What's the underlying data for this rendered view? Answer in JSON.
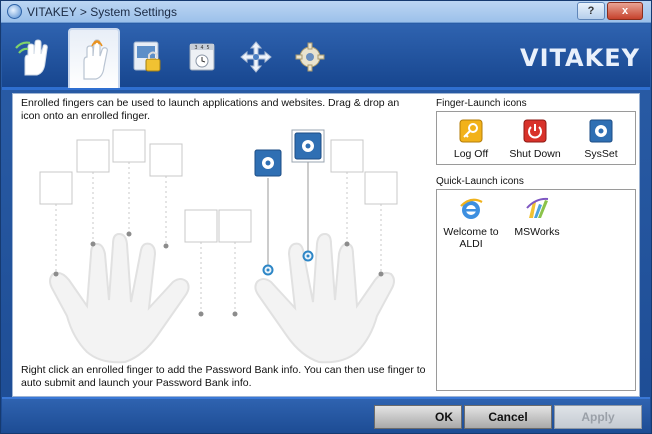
{
  "window": {
    "title": "VITAKEY > System Settings"
  },
  "caption_buttons": {
    "help": "?",
    "close": "x"
  },
  "toolbar": {
    "brand": "VITAKEY",
    "tools": [
      {
        "icon": "hand-wifi-icon"
      },
      {
        "icon": "hand-fingerprint-icon",
        "active": true
      },
      {
        "icon": "password-lock-icon"
      },
      {
        "icon": "time-settings-icon"
      },
      {
        "icon": "move-arrows-icon"
      },
      {
        "icon": "gear-icon"
      }
    ]
  },
  "main": {
    "intro": "Enrolled fingers can be used to launch applications and websites. Drag & drop an icon onto an enrolled finger.",
    "footer_note": "Right click an enrolled finger to add the Password Bank info. You can then use finger to auto submit and launch your Password Bank info."
  },
  "finger_launch": {
    "label": "Finger-Launch icons",
    "items": [
      {
        "label": "Log Off",
        "icon": "key-icon",
        "color": "#f2b21a"
      },
      {
        "label": "Shut Down",
        "icon": "power-icon",
        "color": "#d8322a"
      },
      {
        "label": "SysSet",
        "icon": "gear-icon",
        "color": "#2f6fb3"
      }
    ]
  },
  "quick_launch": {
    "label": "Quick-Launch icons",
    "items": [
      {
        "label_line1": "Welcome to",
        "label_line2": "ALDI",
        "icon": "internet-explorer-icon"
      },
      {
        "label_line1": "MSWorks",
        "label_line2": "",
        "icon": "msworks-icon"
      }
    ]
  },
  "dialog_buttons": {
    "ok": "OK",
    "cancel": "Cancel",
    "apply": "Apply"
  },
  "colors": {
    "title_blue": "#1d4c94",
    "accent": "#2f6fd0"
  }
}
